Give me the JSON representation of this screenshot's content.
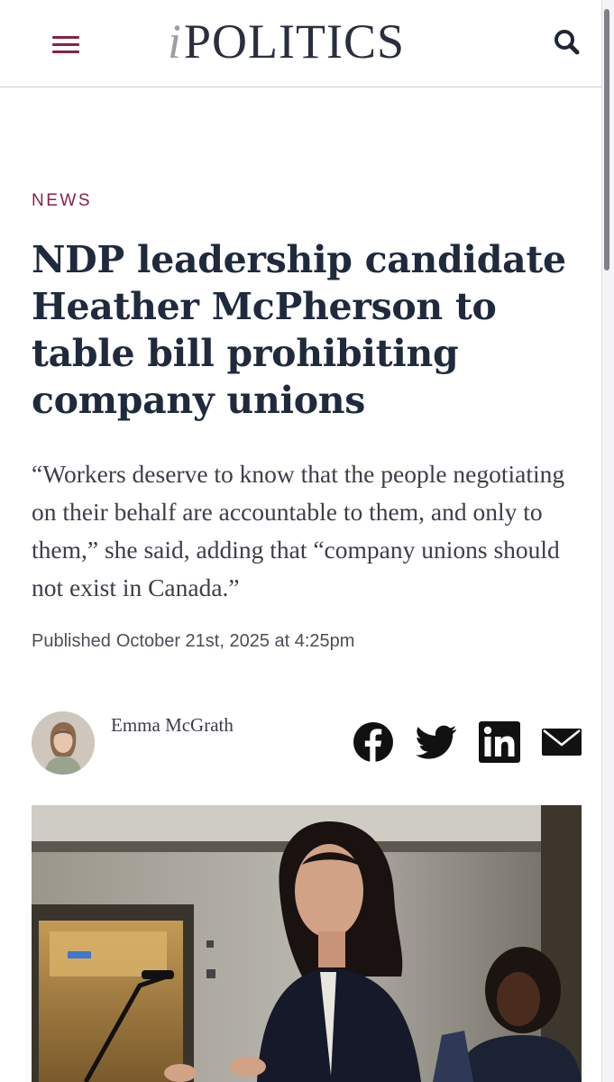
{
  "header": {
    "logo_prefix": "i",
    "logo_text": "POLITICS",
    "menu_icon": "hamburger-menu-icon",
    "search_icon": "search-icon"
  },
  "colors": {
    "brand": "#8a2240",
    "headline": "#1f2a3d",
    "logo": "#2a2f3f"
  },
  "article": {
    "category": "NEWS",
    "headline": "NDP leadership candidate Heather McPherson to table bill prohibiting company unions",
    "dek": "“Workers deserve to know that the people negotiating on their behalf are accountable to them, and only to them,” she said, adding that “company unions should not exist in Canada.”",
    "published_label": "Published",
    "published_date": "October 21st, 2025 at 4:25pm",
    "author": "Emma McGrath"
  },
  "share": [
    {
      "network": "facebook",
      "icon": "facebook-icon"
    },
    {
      "network": "twitter",
      "icon": "twitter-icon"
    },
    {
      "network": "linkedin",
      "icon": "linkedin-icon"
    },
    {
      "network": "email",
      "icon": "email-icon"
    }
  ]
}
